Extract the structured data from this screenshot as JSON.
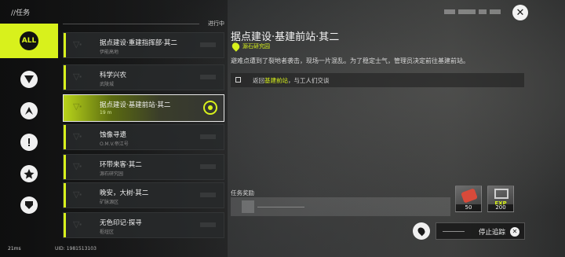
{
  "header": {
    "title": "//任务",
    "close_icon": "close-icon"
  },
  "categories": [
    {
      "label": "ALL",
      "active": true
    },
    {
      "icon": "category-v-icon"
    },
    {
      "icon": "category-splash-icon"
    },
    {
      "icon": "category-exclaim-icon"
    },
    {
      "icon": "category-star-icon"
    },
    {
      "icon": "category-shield-icon"
    }
  ],
  "list": {
    "section_label": "进行中",
    "quests": [
      {
        "name": "据点建设·重建指挥部·其二",
        "sub": "伊能高地"
      },
      {
        "name": "科学兴农",
        "sub": "武陵城"
      },
      {
        "name": "据点建设·基建前站·其二",
        "sub": "19 m",
        "selected": true
      },
      {
        "name": "蚀像寻遗",
        "sub": "O.M.V.帝江号"
      },
      {
        "name": "环带来客·其二",
        "sub": "源石研究园"
      },
      {
        "name": "晚安，大树·其二",
        "sub": "矿脉源区"
      },
      {
        "name": "无色印记·探寻",
        "sub": "枢纽区"
      }
    ]
  },
  "detail": {
    "title": "据点建设·基建前站·其二",
    "location": "源石研究园",
    "description": "避难点遭到了裂地者袭击，现场一片混乱。为了稳定士气，管理员决定前往基建前站。",
    "objective_prefix": "返回",
    "objective_highlight": "基建前站",
    "objective_suffix": "，与工人们交谈"
  },
  "rewards": {
    "label": "任务奖励",
    "items": [
      {
        "icon": "red-gem-icon",
        "qty": "50"
      },
      {
        "icon": "exp-cube-icon",
        "tag": "EXP",
        "qty": "200"
      }
    ]
  },
  "controls": {
    "map_icon": "map-pin-icon",
    "stop_label": "停止追踪"
  },
  "status": {
    "ping": "21ms",
    "uid": "UID: 1981513103"
  }
}
